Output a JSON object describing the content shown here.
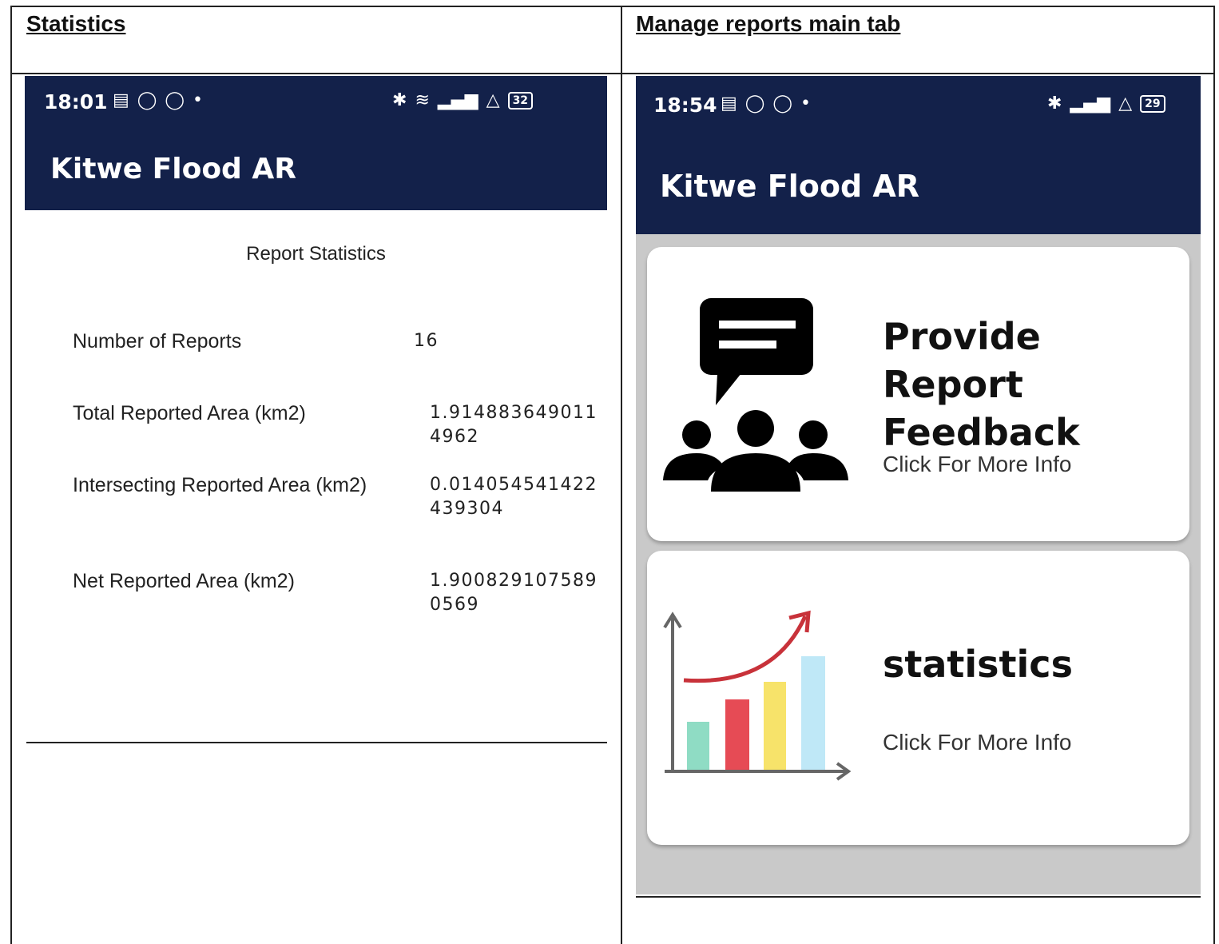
{
  "headings": {
    "left": "Statistics",
    "right": "Manage reports main tab"
  },
  "left_screen": {
    "status_time": "18:01",
    "battery": "32",
    "app_title": "Kitwe Flood AR",
    "section_title": "Report Statistics",
    "stats": [
      {
        "label": "Number of Reports",
        "value": "16"
      },
      {
        "label": "Total Reported Area (km2)",
        "value": "1.9148836490114962"
      },
      {
        "label": "Intersecting Reported Area (km2)",
        "value": "0.014054541422439304"
      },
      {
        "label": "Net Reported Area (km2)",
        "value": "1.9008291075890569"
      }
    ]
  },
  "right_screen": {
    "status_time": "18:54",
    "battery": "29",
    "app_title": "Kitwe Flood AR",
    "cards": [
      {
        "title": "Provide Report Feedback",
        "subtitle": "Click For More Info",
        "icon": "feedback-group-icon"
      },
      {
        "title": "statistics",
        "subtitle": "Click For More Info",
        "icon": "bar-chart-growth-icon"
      }
    ]
  },
  "colors": {
    "appbar": "#13214a",
    "screen_bg": "#c9c9c9"
  }
}
